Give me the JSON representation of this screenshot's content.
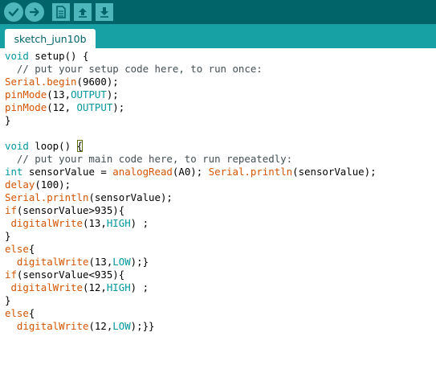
{
  "toolbar": {
    "buttons": [
      {
        "name": "verify-button",
        "icon": "check-icon"
      },
      {
        "name": "upload-button",
        "icon": "arrow-right-icon"
      },
      {
        "name": "new-button",
        "icon": "document-icon"
      },
      {
        "name": "open-button",
        "icon": "arrow-up-icon"
      },
      {
        "name": "save-button",
        "icon": "arrow-down-icon"
      }
    ],
    "colors": {
      "bar": "#006468",
      "button": "#4db7bb",
      "glyph": "#006468"
    }
  },
  "tabs": [
    {
      "label": "sketch_jun10b"
    }
  ],
  "colors": {
    "tab_strip": "#17a1a5",
    "keyword": "#00979c",
    "function": "#d35400",
    "comment": "#434f54"
  },
  "code": {
    "l1": {
      "a": "void",
      "b": " setup() {"
    },
    "l2": {
      "a": "  // put your setup code here, to run once:"
    },
    "l3": {
      "a": "Serial.begin",
      "b": "(9600);"
    },
    "l4": {
      "a": "pinMode",
      "b": "(13,",
      "c": "OUTPUT",
      "d": ");"
    },
    "l5": {
      "a": "pinMode",
      "b": "(12, ",
      "c": "OUTPUT",
      "d": ");"
    },
    "l6": {
      "a": "}"
    },
    "l7": {
      "a": "void",
      "b": " loop() ",
      "c": "{"
    },
    "l8": {
      "a": "  // put your main code here, to run repeatedly:"
    },
    "l9": {
      "a": "int",
      "b": " sensorValue = ",
      "c": "analogRead",
      "d": "(A0); ",
      "e": "Serial.println",
      "f": "(sensorValue);"
    },
    "l10": {
      "a": "delay",
      "b": "(100);"
    },
    "l11": {
      "a": "Serial.println",
      "b": "(sensorValue);"
    },
    "l12": {
      "a": "if",
      "b": "(sensorValue>935){"
    },
    "l13": {
      "a": " digitalWrite",
      "b": "(13,",
      "c": "HIGH",
      "d": ") ;"
    },
    "l14": {
      "a": "}"
    },
    "l15": {
      "a": "else",
      "b": "{"
    },
    "l16": {
      "a": "  digitalWrite",
      "b": "(13,",
      "c": "LOW",
      "d": ");}"
    },
    "l17": {
      "a": "if",
      "b": "(sensorValue<935){"
    },
    "l18": {
      "a": " digitalWrite",
      "b": "(12,",
      "c": "HIGH",
      "d": ") ;"
    },
    "l19": {
      "a": "}"
    },
    "l20": {
      "a": "else",
      "b": "{"
    },
    "l21": {
      "a": "  digitalWrite",
      "b": "(12,",
      "c": "LOW",
      "d": ");}}"
    }
  }
}
